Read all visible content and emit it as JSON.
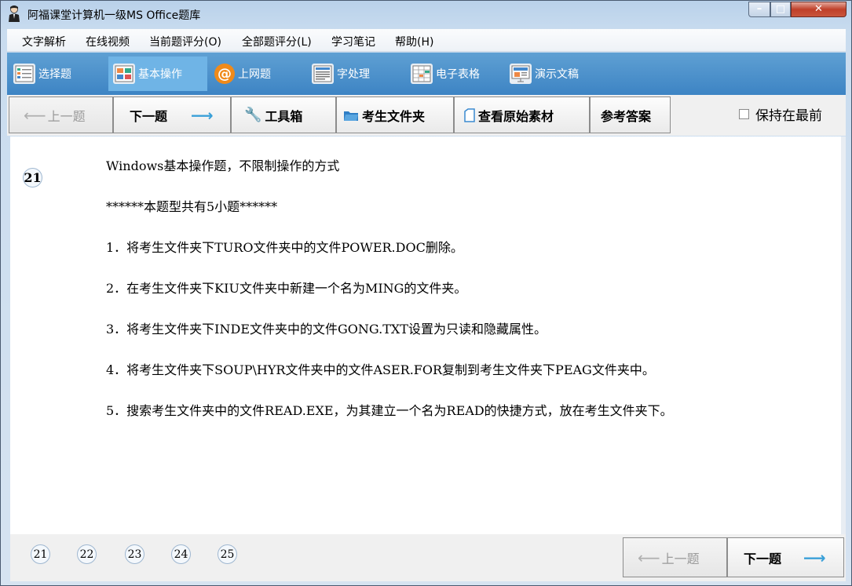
{
  "window": {
    "title": "阿福课堂计算机一级MS Office题库",
    "controls": {
      "minimize": "–",
      "maximize": "□",
      "close": "✕"
    }
  },
  "menu": [
    "文字解析",
    "在线视频",
    "当前题评分(O)",
    "全部题评分(L)",
    "学习笔记",
    "帮助(H)"
  ],
  "categories": [
    {
      "label": "选择题",
      "icon": "choice-icon",
      "active": false
    },
    {
      "label": "基本操作",
      "icon": "basic-ops-icon",
      "active": true
    },
    {
      "label": "上网题",
      "icon": "at-icon",
      "active": false
    },
    {
      "label": "字处理",
      "icon": "word-icon",
      "active": false
    },
    {
      "label": "电子表格",
      "icon": "spreadsheet-icon",
      "active": false
    },
    {
      "label": "演示文稿",
      "icon": "presentation-icon",
      "active": false
    }
  ],
  "toolbar": {
    "prev": "上一题",
    "next": "下一题",
    "toolbox": "工具箱",
    "folder": "考生文件夹",
    "view_source": "查看原始素材",
    "answer": "参考答案",
    "keep_on_top": "保持在最前"
  },
  "question": {
    "number": "21",
    "lines": [
      "Windows基本操作题，不限制操作的方式",
      "******本题型共有5小题******",
      "1．将考生文件夹下TURO文件夹中的文件POWER.DOC删除。",
      "2．在考生文件夹下KIU文件夹中新建一个名为MING的文件夹。",
      "3．将考生文件夹下INDE文件夹中的文件GONG.TXT设置为只读和隐藏属性。",
      "4．将考生文件夹下SOUP\\HYR文件夹中的文件ASER.FOR复制到考生文件夹下PEAG文件夹中。",
      "5．搜索考生文件夹中的文件READ.EXE，为其建立一个名为READ的快捷方式，放在考生文件夹下。"
    ]
  },
  "pages": [
    "21",
    "22",
    "23",
    "24",
    "25"
  ],
  "bottom": {
    "prev": "上一题",
    "next": "下一题"
  },
  "colors": {
    "toolbar_blue": "#4a8fca",
    "active_tab": "#6fb4e6",
    "arrow_blue": "#3aa0d8"
  }
}
